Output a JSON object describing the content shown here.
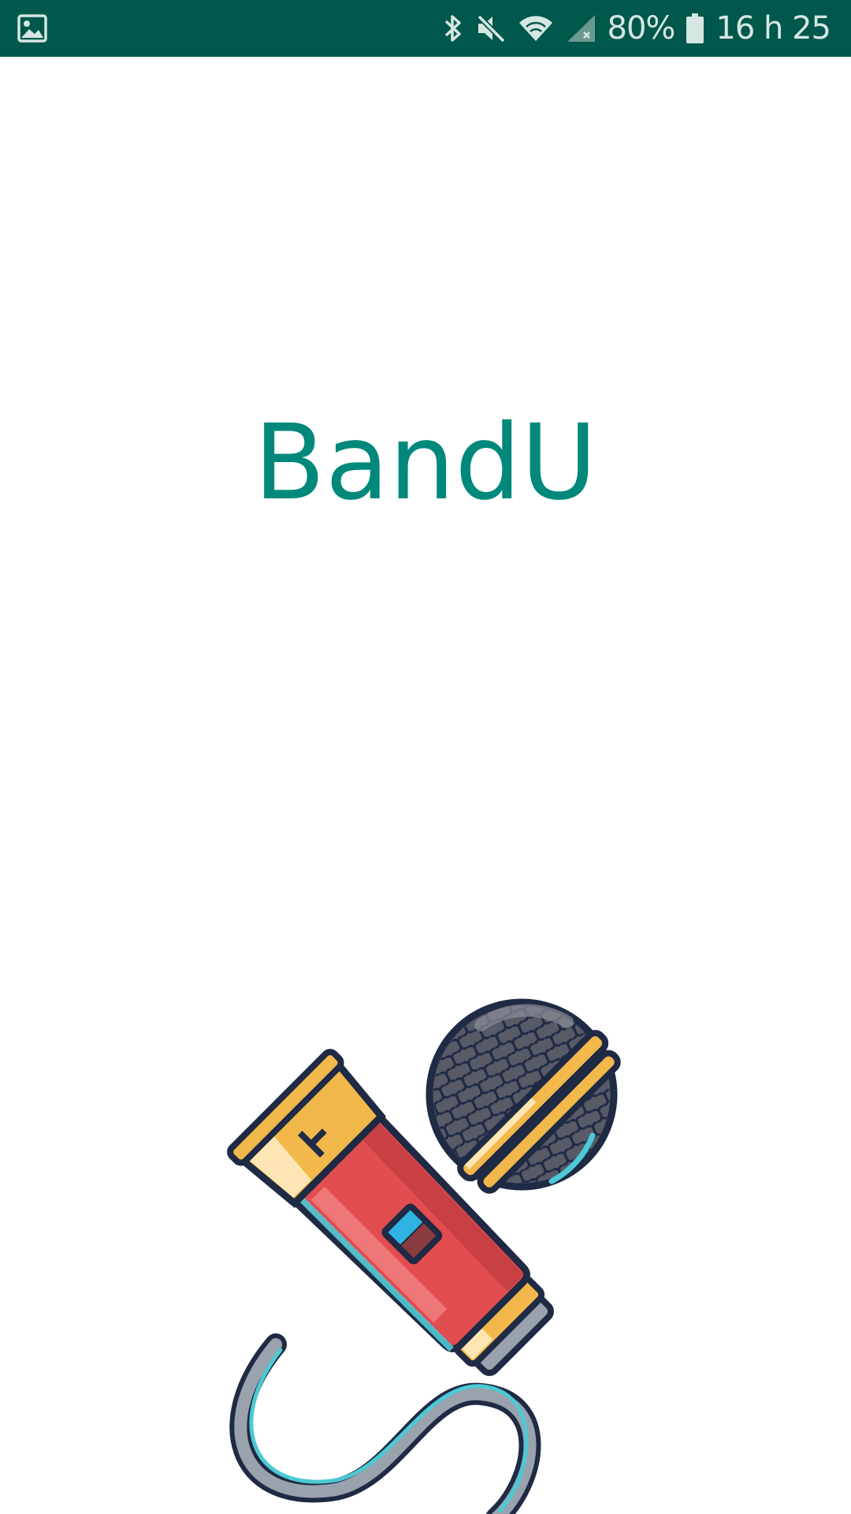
{
  "status_bar": {
    "left_icons": [
      "image-notification-icon"
    ],
    "right_icons": [
      "bluetooth-icon",
      "mute-icon",
      "wifi-icon",
      "cellular-signal-icon",
      "battery-icon"
    ],
    "battery_percent": "80%",
    "time": "16 h 25",
    "background_color": "#00574b"
  },
  "main": {
    "title": "BandU",
    "title_color": "#00897b",
    "illustration": "microphone-icon"
  }
}
